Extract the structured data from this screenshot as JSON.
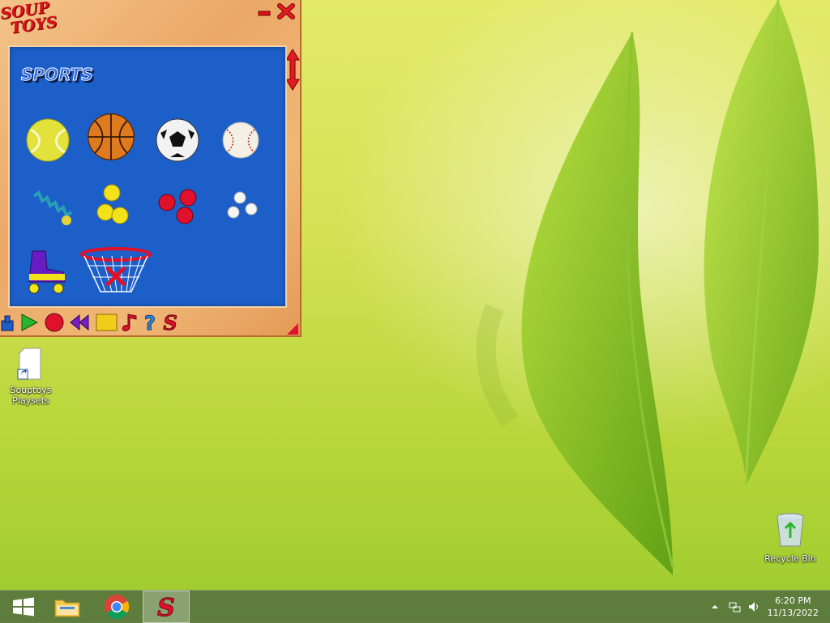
{
  "app": {
    "logo_line1": "SOUP",
    "logo_line2": "TOYS",
    "category_title": "SPORTS",
    "toys": [
      {
        "name": "tennis-ball-icon"
      },
      {
        "name": "basketball-icon"
      },
      {
        "name": "soccer-ball-icon"
      },
      {
        "name": "baseball-icon"
      },
      {
        "name": "spring-icon"
      },
      {
        "name": "yellow-balls-icon"
      },
      {
        "name": "red-balls-icon"
      },
      {
        "name": "white-balls-icon"
      },
      {
        "name": "roller-skate-icon"
      },
      {
        "name": "basketball-hoop-icon"
      }
    ],
    "toolbar_icons": [
      "spawner-icon",
      "play-icon",
      "record-icon",
      "rewind-icon",
      "stop-icon",
      "music-icon",
      "help-icon",
      "soup-s-icon"
    ]
  },
  "desktop": {
    "icons": [
      {
        "label_line1": "Souptoys",
        "label_line2": "Playsets"
      },
      {
        "label_line1": "Recycle Bin"
      }
    ]
  },
  "taskbar": {
    "time": "6:20 PM",
    "date": "11/13/2022"
  },
  "colors": {
    "panel_blue": "#1d5fc9",
    "wood": "#eba866",
    "close_red": "#d8141a",
    "taskbar": "#58763e"
  }
}
